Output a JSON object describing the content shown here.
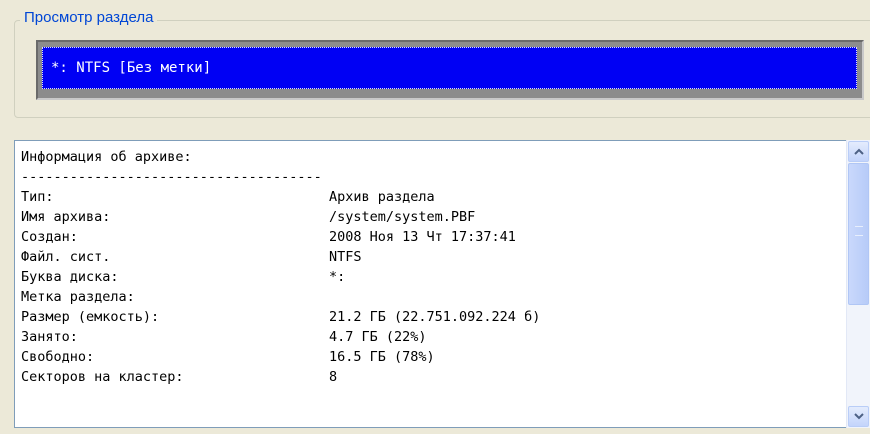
{
  "partition_view": {
    "legend": "Просмотр раздела",
    "selected_partition": "*: NTFS [Без метки]"
  },
  "archive_info": {
    "header": "Информация об архиве:",
    "separator": "-------------------------------------",
    "rows": [
      {
        "label": "Тип:",
        "value": "Архив раздела"
      },
      {
        "label": "Имя архива:",
        "value": "/system/system.PBF"
      },
      {
        "label": "Создан:",
        "value": "2008 Ноя 13 Чт 17:37:41"
      },
      {
        "label": "Файл. сист.",
        "value": "NTFS"
      },
      {
        "label": "Буква диска:",
        "value": "*:"
      },
      {
        "label": "Метка раздела:",
        "value": ""
      },
      {
        "label": "Размер (емкость):",
        "value": "21.2 ГБ (22.751.092.224 б)"
      },
      {
        "label": "Занято:",
        "value": "4.7 ГБ (22%)"
      },
      {
        "label": "Свободно:",
        "value": "16.5 ГБ (78%)"
      },
      {
        "label": "Секторов на кластер:",
        "value": "8"
      }
    ]
  },
  "colors": {
    "selection": "#0000f4",
    "legend_text": "#0046d5",
    "window_bg": "#ece9d8"
  }
}
